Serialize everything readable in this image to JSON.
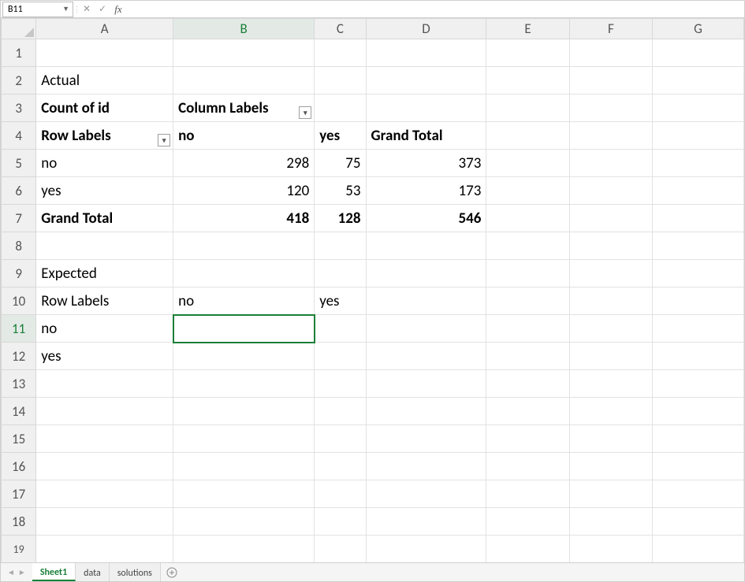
{
  "formula_bar": {
    "name_box_value": "B11",
    "cancel_glyph": "✕",
    "accept_glyph": "✓",
    "fx_label": "fx",
    "input_value": ""
  },
  "columns": [
    "A",
    "B",
    "C",
    "D",
    "E",
    "F",
    "G"
  ],
  "row_numbers": [
    "1",
    "2",
    "3",
    "4",
    "5",
    "6",
    "7",
    "8",
    "9",
    "10",
    "11",
    "12",
    "13",
    "14",
    "15",
    "16",
    "17",
    "18",
    "19"
  ],
  "cells": {
    "r2": {
      "A": "Actual"
    },
    "r3": {
      "A": "Count of id",
      "B": "Column Labels"
    },
    "r4": {
      "A": "Row Labels",
      "B": "no",
      "C": "yes",
      "D": "Grand Total"
    },
    "r5": {
      "A": "no",
      "B": "298",
      "C": "75",
      "D": "373"
    },
    "r6": {
      "A": "yes",
      "B": "120",
      "C": "53",
      "D": "173"
    },
    "r7": {
      "A": "Grand Total",
      "B": "418",
      "C": "128",
      "D": "546"
    },
    "r9": {
      "A": "Expected"
    },
    "r10": {
      "A": "Row Labels",
      "B": "no",
      "C": "yes"
    },
    "r11": {
      "A": "no"
    },
    "r12": {
      "A": "yes"
    }
  },
  "sheet_tabs": {
    "items": [
      {
        "label": "Sheet1",
        "active": true
      },
      {
        "label": "data",
        "active": false
      },
      {
        "label": "solutions",
        "active": false
      }
    ]
  },
  "filter_glyph": "▾"
}
